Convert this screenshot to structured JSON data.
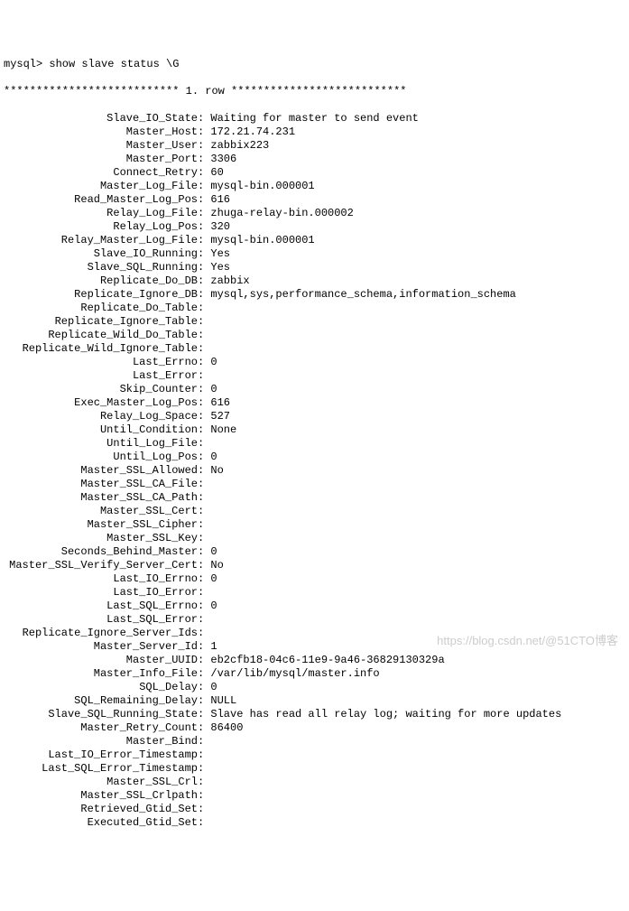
{
  "prompt": "mysql> show slave status \\G",
  "separator": "*************************** 1. row ***************************",
  "fields": [
    {
      "label": "Slave_IO_State",
      "value": "Waiting for master to send event"
    },
    {
      "label": "Master_Host",
      "value": "172.21.74.231"
    },
    {
      "label": "Master_User",
      "value": "zabbix223"
    },
    {
      "label": "Master_Port",
      "value": "3306"
    },
    {
      "label": "Connect_Retry",
      "value": "60"
    },
    {
      "label": "Master_Log_File",
      "value": "mysql-bin.000001"
    },
    {
      "label": "Read_Master_Log_Pos",
      "value": "616"
    },
    {
      "label": "Relay_Log_File",
      "value": "zhuga-relay-bin.000002"
    },
    {
      "label": "Relay_Log_Pos",
      "value": "320"
    },
    {
      "label": "Relay_Master_Log_File",
      "value": "mysql-bin.000001"
    },
    {
      "label": "Slave_IO_Running",
      "value": "Yes"
    },
    {
      "label": "Slave_SQL_Running",
      "value": "Yes"
    },
    {
      "label": "Replicate_Do_DB",
      "value": "zabbix"
    },
    {
      "label": "Replicate_Ignore_DB",
      "value": "mysql,sys,performance_schema,information_schema"
    },
    {
      "label": "Replicate_Do_Table",
      "value": ""
    },
    {
      "label": "Replicate_Ignore_Table",
      "value": ""
    },
    {
      "label": "Replicate_Wild_Do_Table",
      "value": ""
    },
    {
      "label": "Replicate_Wild_Ignore_Table",
      "value": ""
    },
    {
      "label": "Last_Errno",
      "value": "0"
    },
    {
      "label": "Last_Error",
      "value": ""
    },
    {
      "label": "Skip_Counter",
      "value": "0"
    },
    {
      "label": "Exec_Master_Log_Pos",
      "value": "616"
    },
    {
      "label": "Relay_Log_Space",
      "value": "527"
    },
    {
      "label": "Until_Condition",
      "value": "None"
    },
    {
      "label": "Until_Log_File",
      "value": ""
    },
    {
      "label": "Until_Log_Pos",
      "value": "0"
    },
    {
      "label": "Master_SSL_Allowed",
      "value": "No"
    },
    {
      "label": "Master_SSL_CA_File",
      "value": ""
    },
    {
      "label": "Master_SSL_CA_Path",
      "value": ""
    },
    {
      "label": "Master_SSL_Cert",
      "value": ""
    },
    {
      "label": "Master_SSL_Cipher",
      "value": ""
    },
    {
      "label": "Master_SSL_Key",
      "value": ""
    },
    {
      "label": "Seconds_Behind_Master",
      "value": "0"
    },
    {
      "label": "Master_SSL_Verify_Server_Cert",
      "value": "No"
    },
    {
      "label": "Last_IO_Errno",
      "value": "0"
    },
    {
      "label": "Last_IO_Error",
      "value": ""
    },
    {
      "label": "Last_SQL_Errno",
      "value": "0"
    },
    {
      "label": "Last_SQL_Error",
      "value": ""
    },
    {
      "label": "Replicate_Ignore_Server_Ids",
      "value": ""
    },
    {
      "label": "Master_Server_Id",
      "value": "1"
    },
    {
      "label": "Master_UUID",
      "value": "eb2cfb18-04c6-11e9-9a46-36829130329a"
    },
    {
      "label": "Master_Info_File",
      "value": "/var/lib/mysql/master.info"
    },
    {
      "label": "SQL_Delay",
      "value": "0"
    },
    {
      "label": "SQL_Remaining_Delay",
      "value": "NULL"
    },
    {
      "label": "Slave_SQL_Running_State",
      "value": "Slave has read all relay log; waiting for more updates"
    },
    {
      "label": "Master_Retry_Count",
      "value": "86400"
    },
    {
      "label": "Master_Bind",
      "value": ""
    },
    {
      "label": "Last_IO_Error_Timestamp",
      "value": ""
    },
    {
      "label": "Last_SQL_Error_Timestamp",
      "value": ""
    },
    {
      "label": "Master_SSL_Crl",
      "value": ""
    },
    {
      "label": "Master_SSL_Crlpath",
      "value": ""
    },
    {
      "label": "Retrieved_Gtid_Set",
      "value": ""
    },
    {
      "label": "Executed_Gtid_Set",
      "value": ""
    }
  ],
  "watermark": "https://blog.csdn.net/@51CTO博客"
}
